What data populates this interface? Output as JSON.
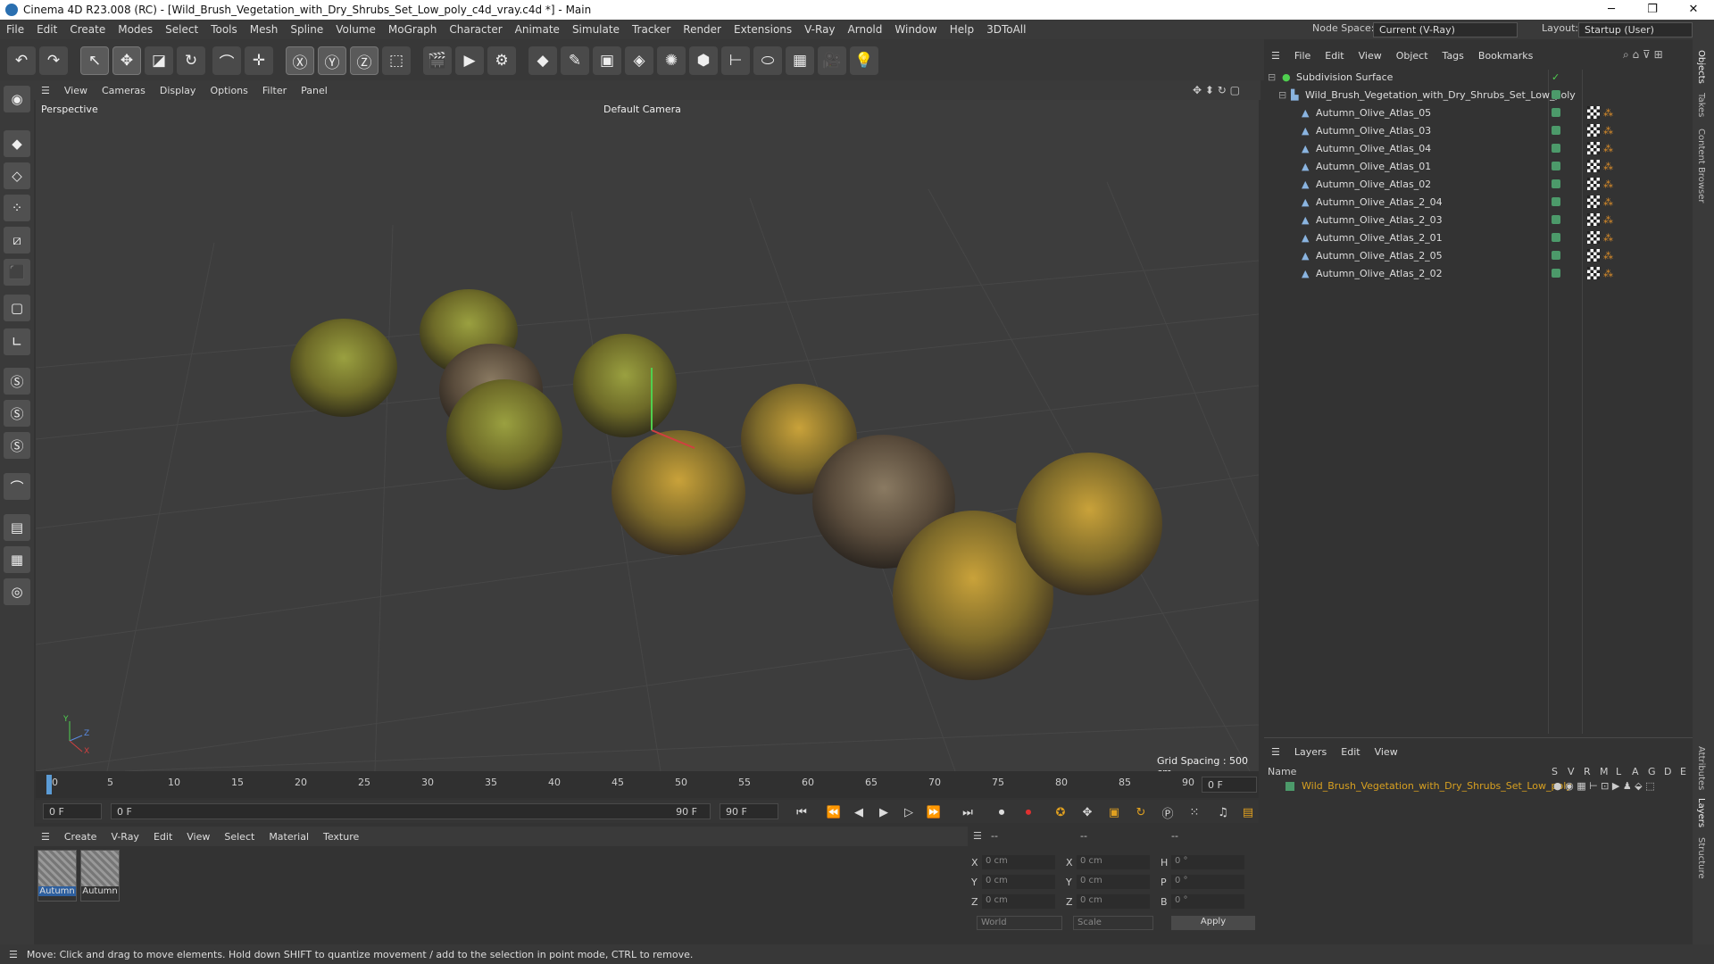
{
  "window": {
    "title": "Cinema 4D R23.008 (RC) - [Wild_Brush_Vegetation_with_Dry_Shrubs_Set_Low_poly_c4d_vray.c4d *] - Main"
  },
  "menu": [
    "File",
    "Edit",
    "Create",
    "Modes",
    "Select",
    "Tools",
    "Mesh",
    "Spline",
    "Volume",
    "MoGraph",
    "Character",
    "Animate",
    "Simulate",
    "Tracker",
    "Render",
    "Extensions",
    "V-Ray",
    "Arnold",
    "Window",
    "Help",
    "3DToAll"
  ],
  "node_space": {
    "label": "Node Space:",
    "value": "Current (V-Ray)"
  },
  "layout": {
    "label": "Layout:",
    "value": "Startup (User)"
  },
  "viewport": {
    "menu": [
      "View",
      "Cameras",
      "Display",
      "Options",
      "Filter",
      "Panel"
    ],
    "name": "Perspective",
    "camera": "Default Camera",
    "grid": "Grid Spacing : 500 cm"
  },
  "timeline": {
    "ticks": [
      "0",
      "5",
      "10",
      "15",
      "20",
      "25",
      "30",
      "35",
      "40",
      "45",
      "50",
      "55",
      "60",
      "65",
      "70",
      "75",
      "80",
      "85",
      "90"
    ],
    "end_field": "0 F"
  },
  "playback": {
    "start": "0 F",
    "current": "0 F",
    "range_end": "90 F",
    "end": "90 F"
  },
  "material": {
    "menu": [
      "Create",
      "V-Ray",
      "Edit",
      "View",
      "Select",
      "Material",
      "Texture"
    ],
    "items": [
      "Autumn",
      "Autumn"
    ]
  },
  "coords": {
    "headers": [
      "--",
      "--",
      "--"
    ],
    "rows": [
      {
        "a": "X",
        "av": "0 cm",
        "b": "X",
        "bv": "0 cm",
        "c": "H",
        "cv": "0 °"
      },
      {
        "a": "Y",
        "av": "0 cm",
        "b": "Y",
        "bv": "0 cm",
        "c": "P",
        "cv": "0 °"
      },
      {
        "a": "Z",
        "av": "0 cm",
        "b": "Z",
        "bv": "0 cm",
        "c": "B",
        "cv": "0 °"
      }
    ],
    "space": "World",
    "mode": "Scale",
    "apply": "Apply"
  },
  "objects": {
    "menu": [
      "File",
      "Edit",
      "View",
      "Object",
      "Tags",
      "Bookmarks"
    ],
    "root": "Subdivision Surface",
    "group": "Wild_Brush_Vegetation_with_Dry_Shrubs_Set_Low_poly",
    "items": [
      "Autumn_Olive_Atlas_05",
      "Autumn_Olive_Atlas_03",
      "Autumn_Olive_Atlas_04",
      "Autumn_Olive_Atlas_01",
      "Autumn_Olive_Atlas_02",
      "Autumn_Olive_Atlas_2_04",
      "Autumn_Olive_Atlas_2_03",
      "Autumn_Olive_Atlas_2_01",
      "Autumn_Olive_Atlas_2_05",
      "Autumn_Olive_Atlas_2_02"
    ]
  },
  "layers": {
    "menu": [
      "Layers",
      "Edit",
      "View"
    ],
    "name_header": "Name",
    "cols": [
      "S",
      "V",
      "R",
      "M",
      "L",
      "A",
      "G",
      "D",
      "E"
    ],
    "item": "Wild_Brush_Vegetation_with_Dry_Shrubs_Set_Low_poly"
  },
  "side_tabs": [
    "Objects",
    "Takes",
    "Content Browser",
    "Attributes",
    "Layers",
    "Structure"
  ],
  "status": "Move: Click and drag to move elements. Hold down SHIFT to quantize movement / add to the selection in point mode, CTRL to remove.",
  "colors": {
    "accent": "#d8a020",
    "layer": "#d8a020",
    "tag": "#4c9a6a"
  }
}
